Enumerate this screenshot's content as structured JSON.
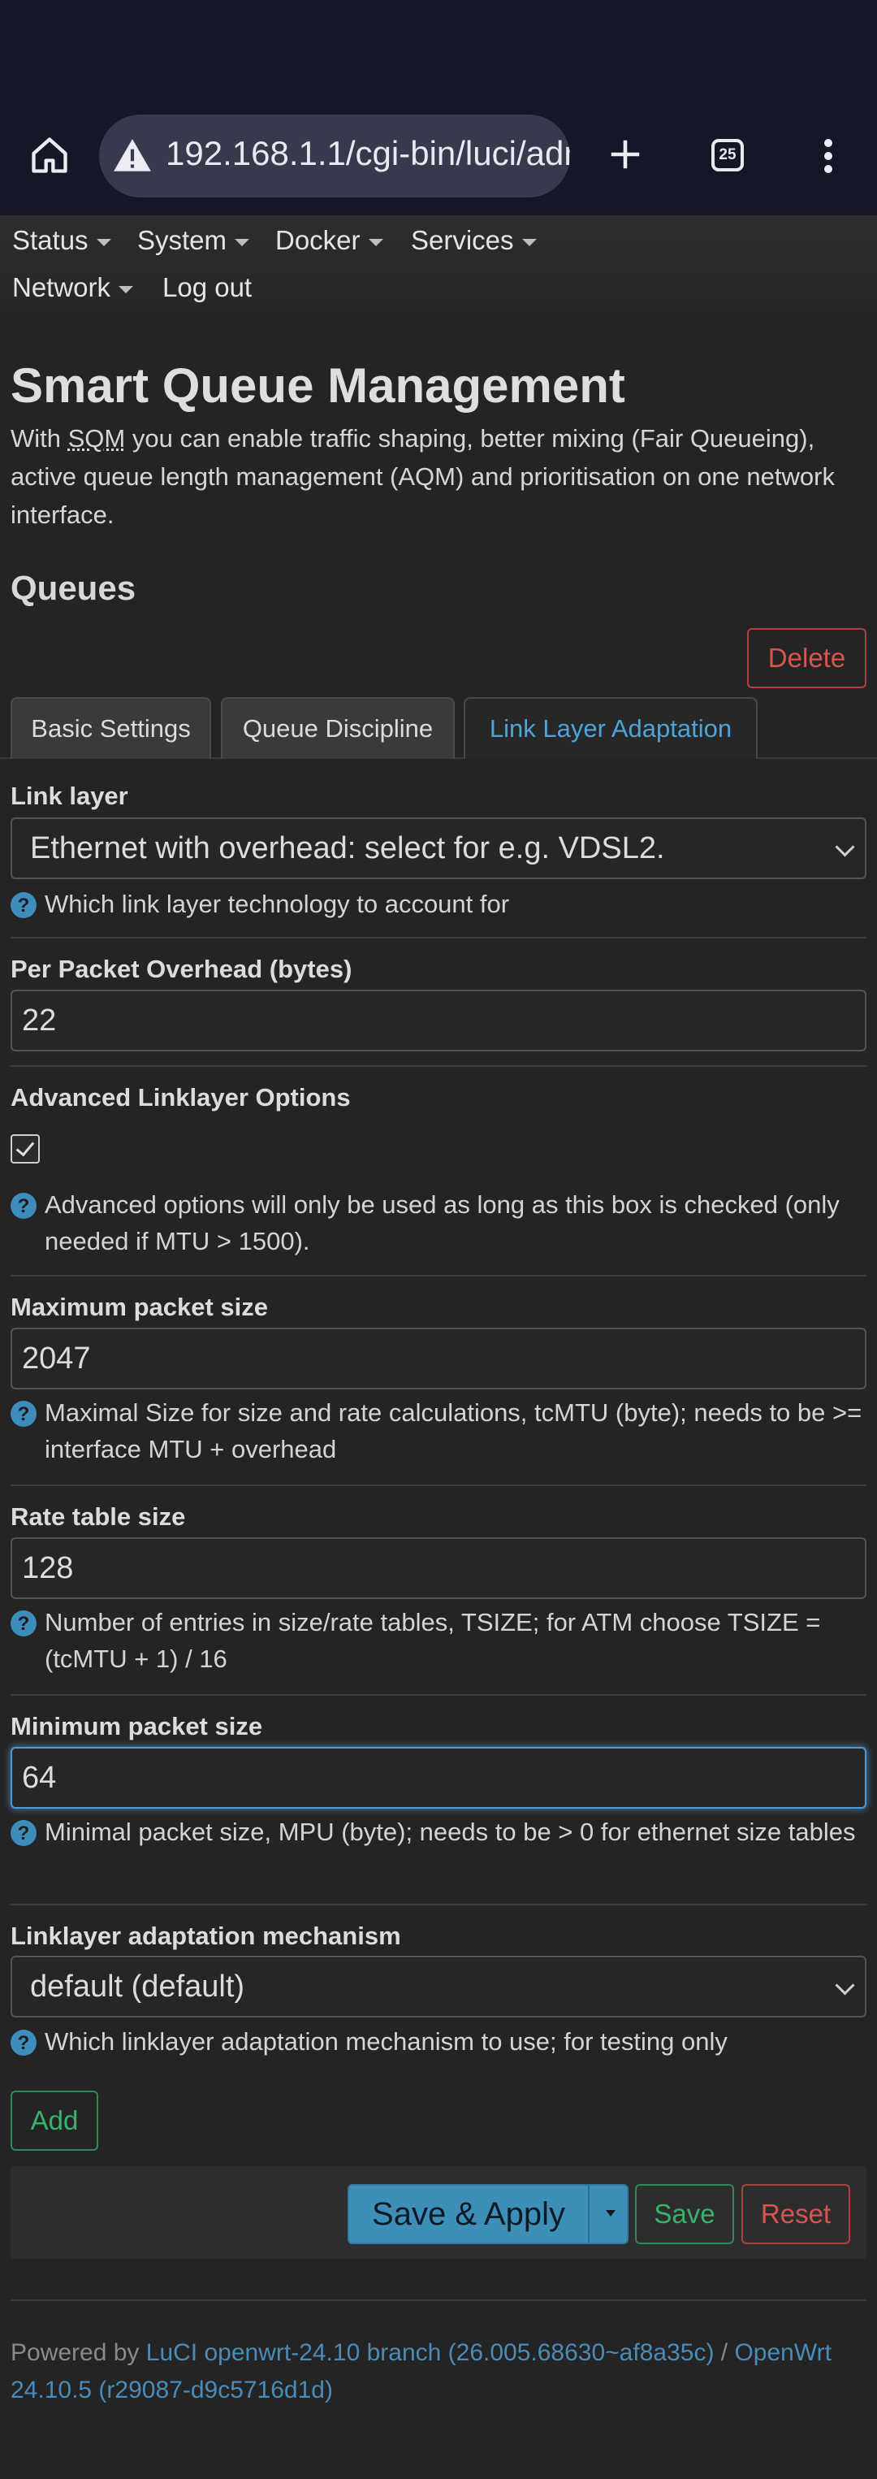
{
  "browser": {
    "url": "192.168.1.1/cgi-bin/luci/adm",
    "tab_count": "25"
  },
  "nav": {
    "items": [
      {
        "label": "Status"
      },
      {
        "label": "System"
      },
      {
        "label": "Docker"
      },
      {
        "label": "Services"
      },
      {
        "label": "Network"
      }
    ],
    "logout": "Log out"
  },
  "page": {
    "title": "Smart Queue Management",
    "intro_prefix": "With ",
    "intro_abbr": "SQM",
    "intro_suffix": " you can enable traffic shaping, better mixing (Fair Queueing), active queue length management (AQM) and prioritisation on one network interface.",
    "section_title": "Queues",
    "delete_label": "Delete"
  },
  "tabs": [
    {
      "label": "Basic Settings"
    },
    {
      "label": "Queue Discipline"
    },
    {
      "label": "Link Layer Adaptation"
    }
  ],
  "fields": {
    "link_layer": {
      "label": "Link layer",
      "value": "Ethernet with overhead: select for e.g. VDSL2.",
      "help": "Which link layer technology to account for"
    },
    "overhead": {
      "label": "Per Packet Overhead (bytes)",
      "value": "22"
    },
    "advanced": {
      "label": "Advanced Linklayer Options",
      "checked": true,
      "help": "Advanced options will only be used as long as this box is checked (only needed if MTU > 1500)."
    },
    "max_packet": {
      "label": "Maximum packet size",
      "value": "2047",
      "help": "Maximal Size for size and rate calculations, tcMTU (byte); needs to be >= interface MTU + overhead"
    },
    "rate_table": {
      "label": "Rate table size",
      "value": "128",
      "help": "Number of entries in size/rate tables, TSIZE; for ATM choose TSIZE = (tcMTU + 1) / 16"
    },
    "min_packet": {
      "label": "Minimum packet size",
      "value": "64",
      "help": "Minimal packet size, MPU (byte); needs to be > 0 for ethernet size tables"
    },
    "mechanism": {
      "label": "Linklayer adaptation mechanism",
      "value": "default (default)",
      "help": "Which linklayer adaptation mechanism to use; for testing only"
    }
  },
  "actions": {
    "add": "Add",
    "save_apply": "Save & Apply",
    "save": "Save",
    "reset": "Reset"
  },
  "footer": {
    "powered_by": "Powered by ",
    "luci_link": "LuCI openwrt-24.10 branch (26.005.68630~af8a35c)",
    "sep": " / ",
    "openwrt_link": "OpenWrt 24.10.5 (r29087-d9c5716d1d)"
  },
  "colors": {
    "accent": "#4ea4d9",
    "danger": "#d9534f",
    "success": "#36b36b",
    "background": "#242424"
  }
}
